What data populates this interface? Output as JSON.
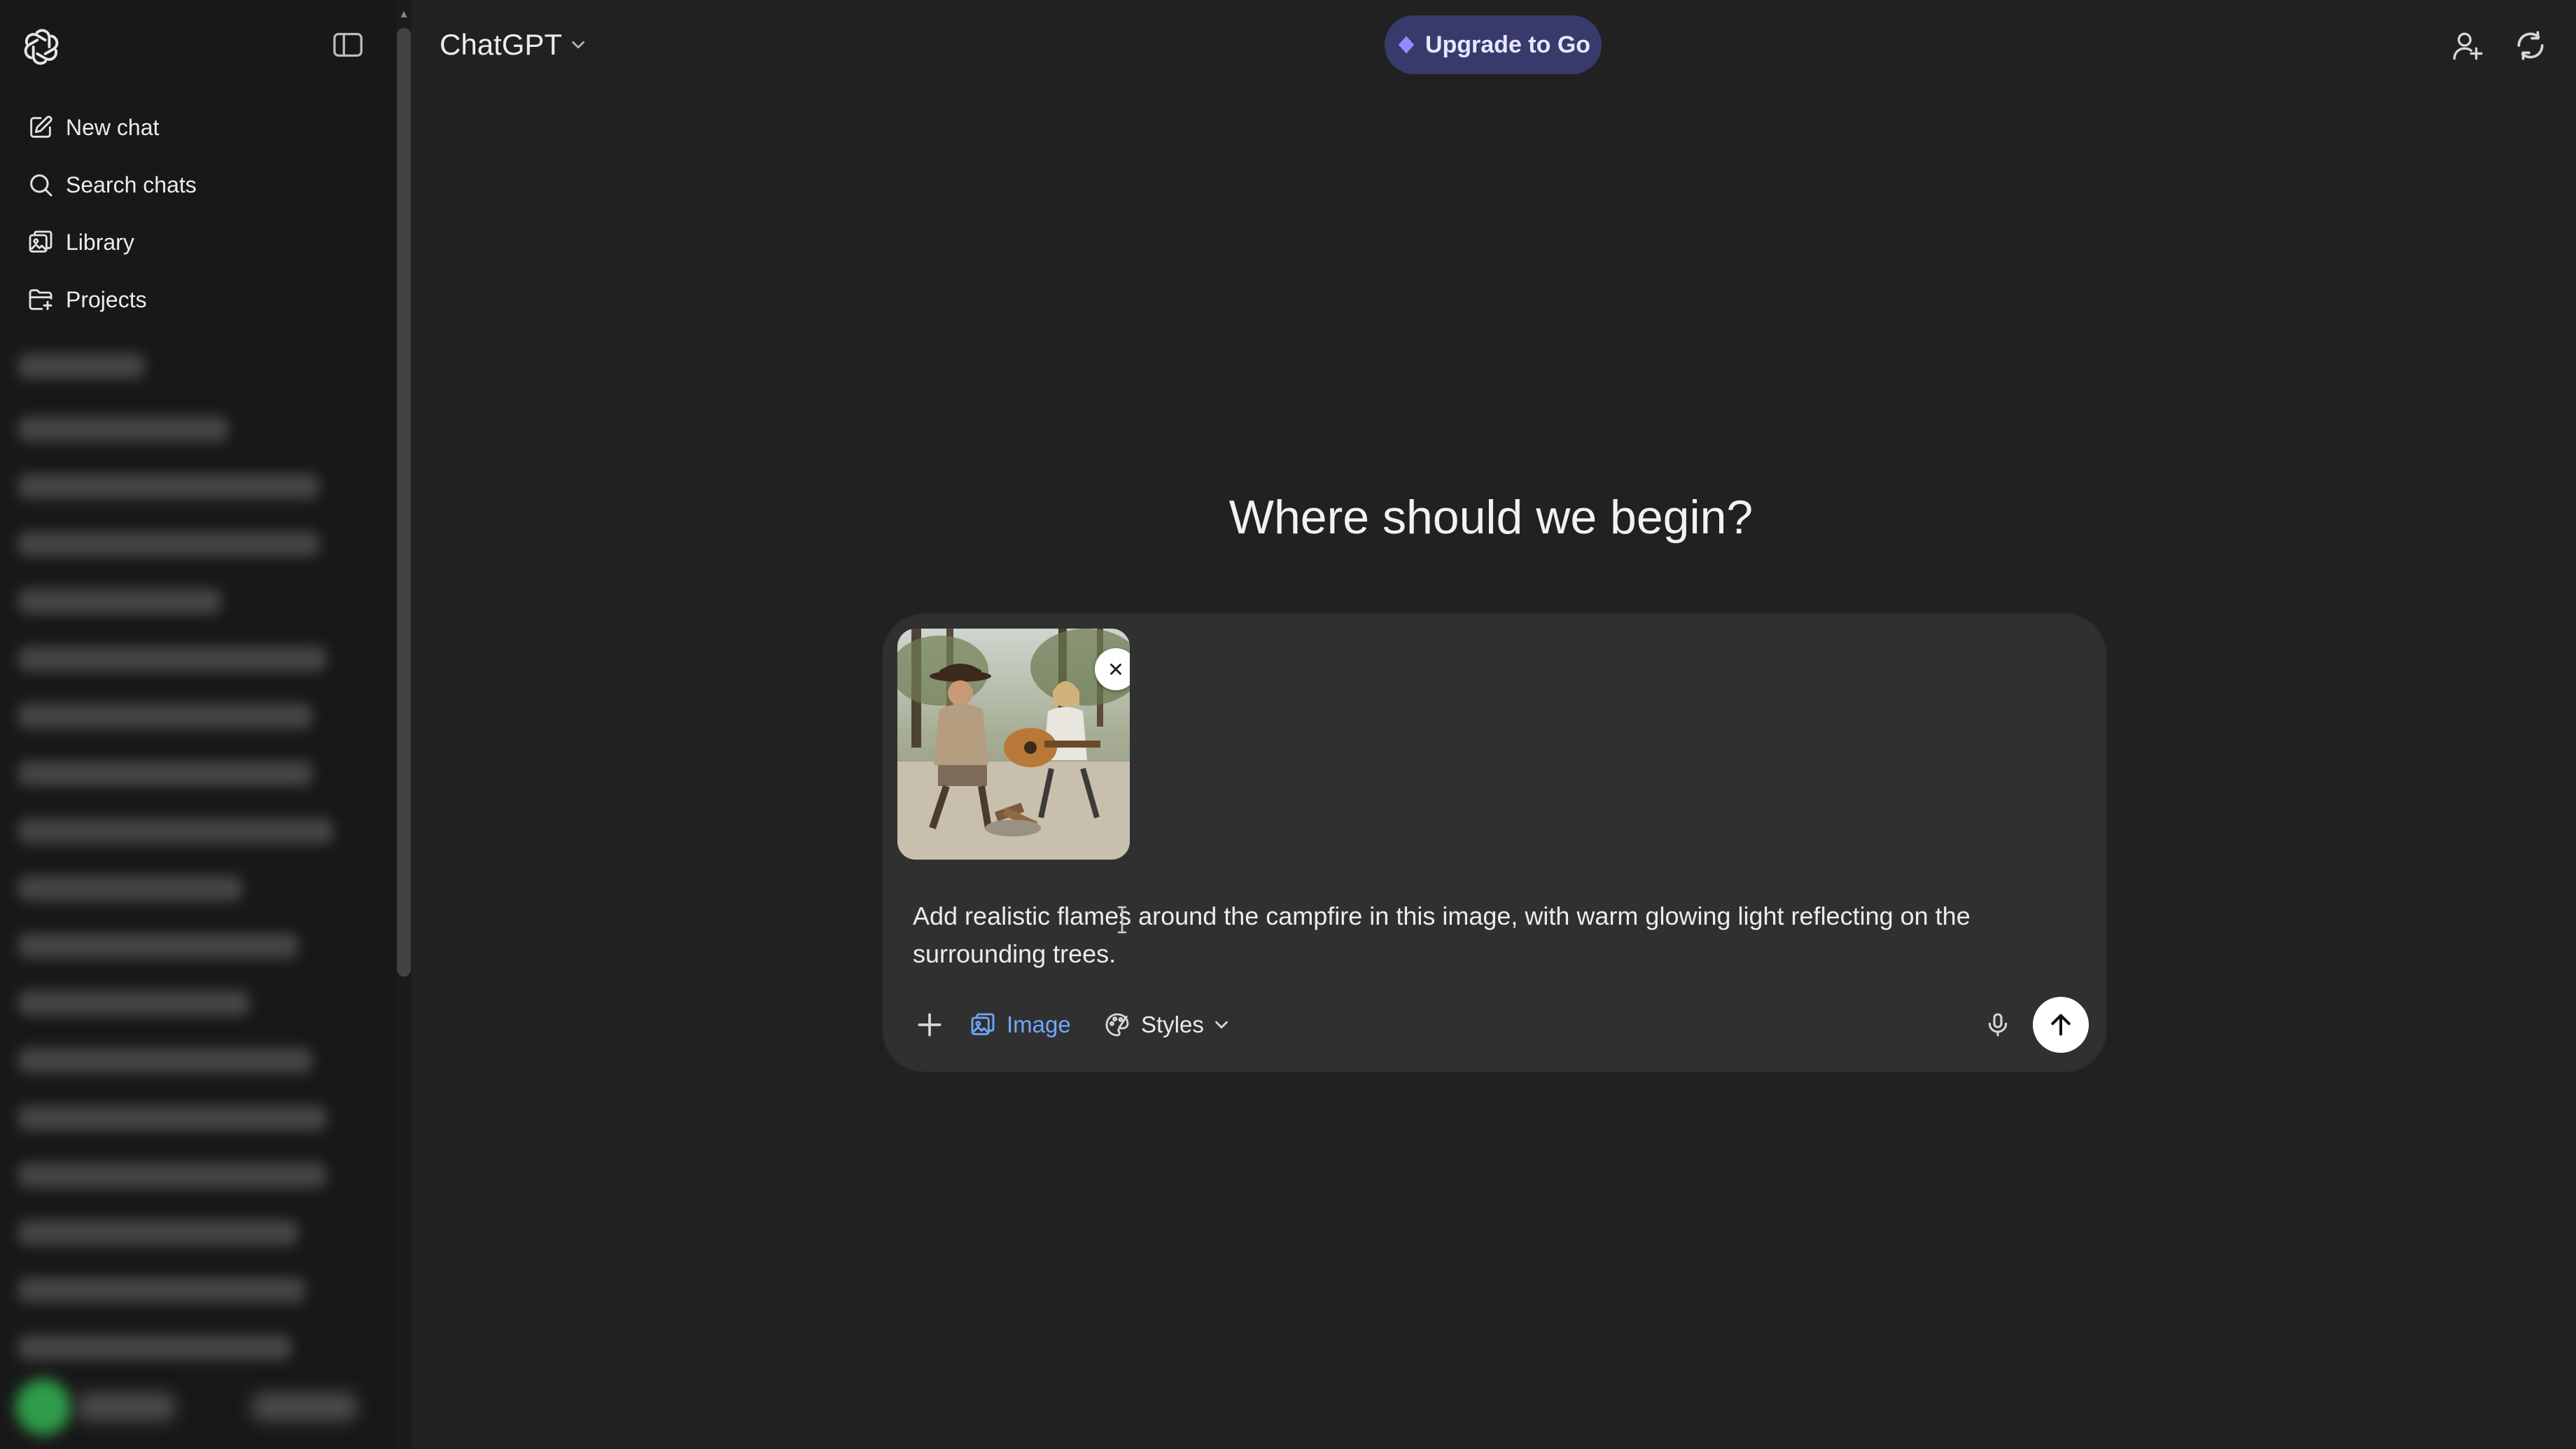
{
  "app": {
    "model_label": "ChatGPT"
  },
  "sidebar": {
    "items": [
      {
        "label": "New chat",
        "icon": "edit-icon"
      },
      {
        "label": "Search chats",
        "icon": "search-icon"
      },
      {
        "label": "Library",
        "icon": "library-icon"
      },
      {
        "label": "Projects",
        "icon": "folder-icon"
      }
    ]
  },
  "header": {
    "upgrade_label": "Upgrade to Go"
  },
  "main": {
    "headline": "Where should we begin?"
  },
  "composer": {
    "prompt": "Add realistic flames around the campfire in this image, with warm glowing light reflecting on the surrounding trees.",
    "image_label": "Image",
    "styles_label": "Styles"
  },
  "colors": {
    "background": "#212121",
    "sidebar": "#181818",
    "composer": "#303030",
    "upgrade_pill": "#393a6c",
    "accent_blue": "#71a6ff"
  }
}
